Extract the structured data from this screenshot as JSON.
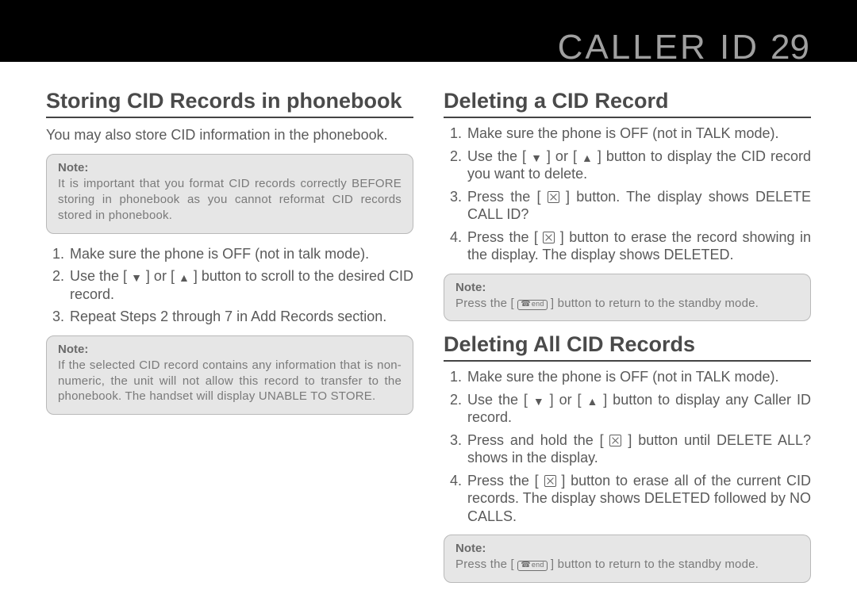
{
  "header": {
    "title": "CALLER ID",
    "page": "29"
  },
  "left": {
    "heading": "Storing CID Records in phonebook",
    "intro": "You may also store CID information in the phonebook.",
    "note1_title": "Note:",
    "note1_body": "It is important that you format CID records correctly BEFORE storing in phonebook as you cannot reformat CID records stored in phonebook.",
    "step1": "Make sure the phone is OFF (not in talk mode).",
    "step2_a": "Use the [ ",
    "step2_b": " ] or [ ",
    "step2_c": " ] button to scroll to the desired CID record.",
    "step3": "Repeat Steps 2 through 7 in Add Records section.",
    "note2_title": "Note:",
    "note2_body": "If the selected CID record contains any information that is non-numeric, the unit will not allow this record to transfer to the phonebook. The handset will display UNABLE TO STORE."
  },
  "right": {
    "heading1": "Deleting a CID Record",
    "d_step1": "Make sure the phone is OFF (not in TALK mode).",
    "d_step2_a": "Use the [ ",
    "d_step2_b": " ] or [ ",
    "d_step2_c": " ] button to display the CID record you want to delete.",
    "d_step3_a": "Press the [ ",
    "d_step3_b": " ] button. The display shows DELETE CALL ID?",
    "d_step4_a": "Press the [ ",
    "d_step4_b": " ] button to erase the record showing in the display. The display shows DELETED.",
    "note1_title": "Note:",
    "note1_a": "Press the [ ",
    "note1_b": " ] button to return to the standby mode.",
    "heading2": "Deleting All CID Records",
    "a_step1": "Make sure the phone is OFF (not in TALK mode).",
    "a_step2_a": "Use the [ ",
    "a_step2_b": " ] or [ ",
    "a_step2_c": " ] button to display any Caller ID record.",
    "a_step3_a": "Press and hold the [ ",
    "a_step3_b": " ] button until DELETE ALL? shows in the display.",
    "a_step4_a": "Press the [ ",
    "a_step4_b": " ] button to erase all of the current CID records. The display shows DELETED followed by NO CALLS.",
    "note2_title": "Note:",
    "note2_a": "Press the [ ",
    "note2_b": " ] button to return to the standby mode."
  },
  "icons": {
    "down": "▼",
    "up": "▲",
    "end_label": "end"
  }
}
